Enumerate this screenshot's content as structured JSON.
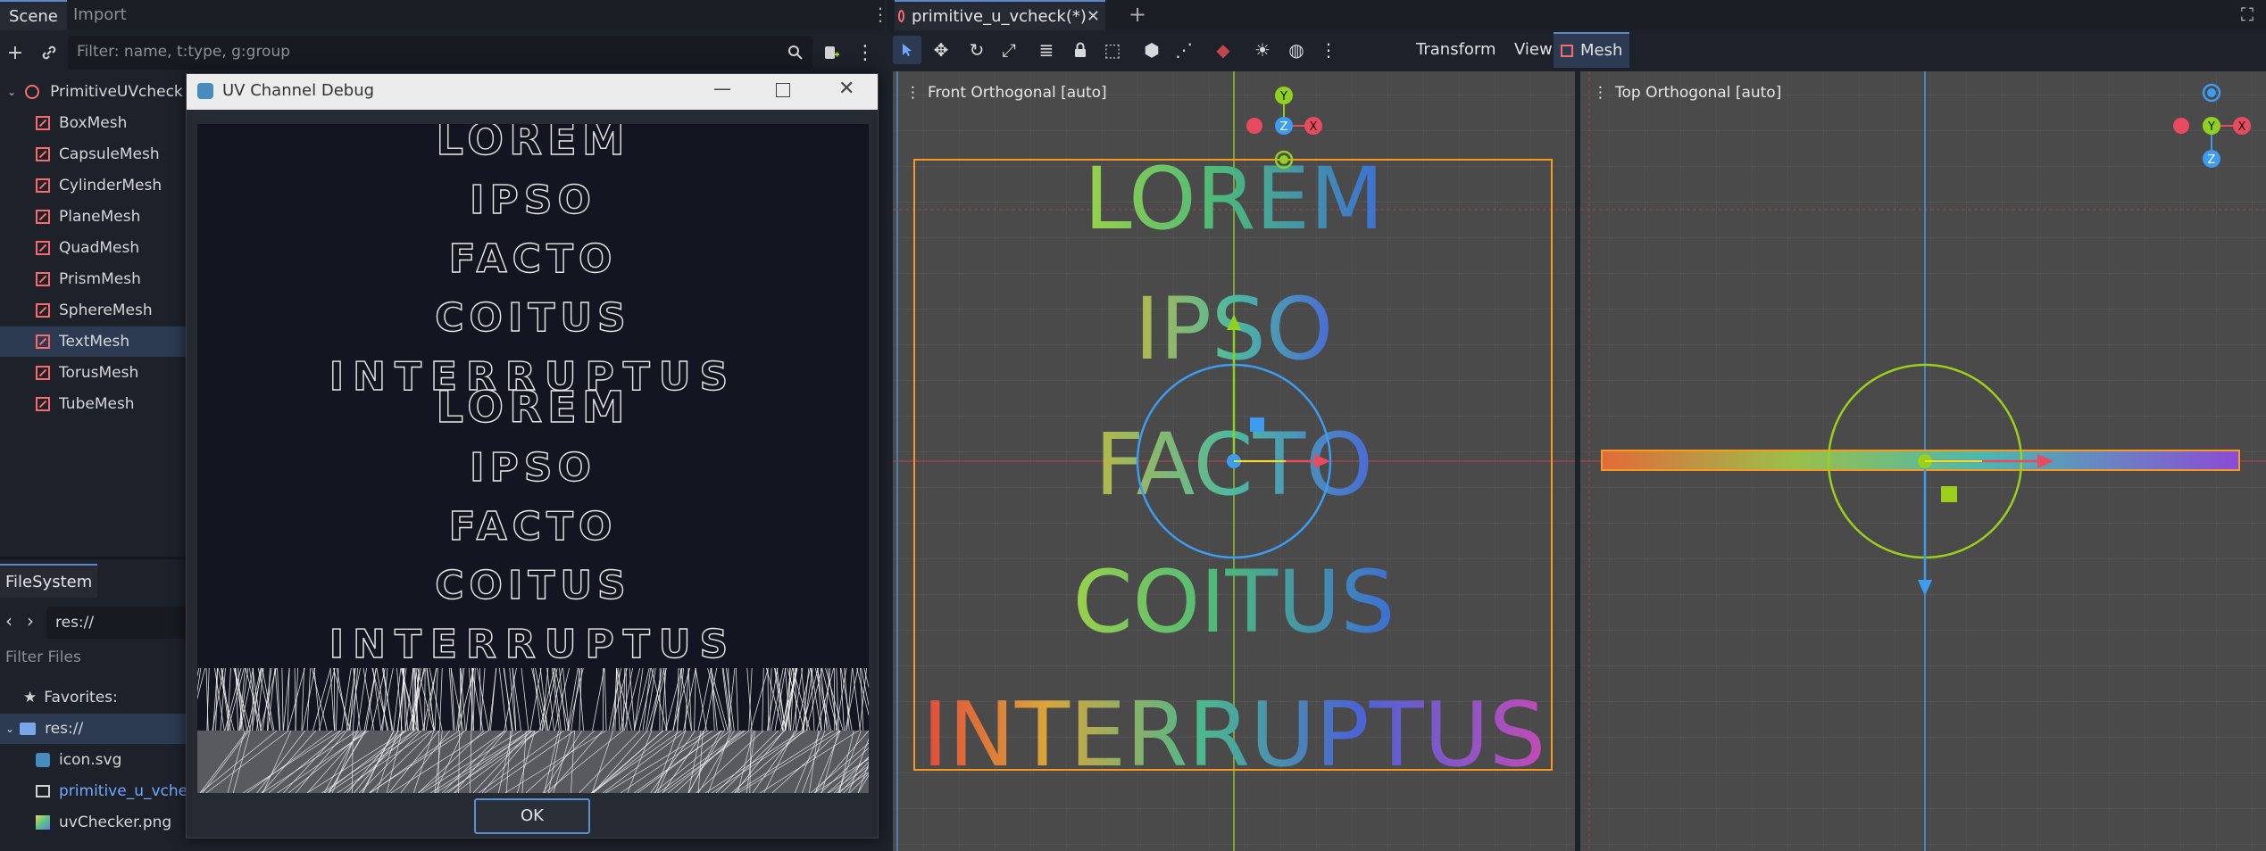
{
  "scene_dock": {
    "tabs": [
      "Scene",
      "Import"
    ],
    "filter_placeholder": "Filter: name, t:type, g:group",
    "root_node": "PrimitiveUVcheck",
    "nodes": [
      "BoxMesh",
      "CapsuleMesh",
      "CylinderMesh",
      "PlaneMesh",
      "QuadMesh",
      "PrismMesh",
      "SphereMesh",
      "TextMesh",
      "TorusMesh",
      "TubeMesh"
    ],
    "selected_node": "TextMesh"
  },
  "filesystem": {
    "tab": "FileSystem",
    "path": "res://",
    "filter_placeholder": "Filter Files",
    "favorites": "Favorites:",
    "root": "res://",
    "files": [
      "icon.svg",
      "primitive_u_vcheck",
      "uvChecker.png"
    ]
  },
  "dialog": {
    "title": "UV Channel Debug",
    "ok_label": "OK",
    "words": [
      "LOREM",
      "IPSO",
      "FACTO",
      "COITUS",
      "INTERRUPTUS"
    ]
  },
  "editor": {
    "scene_tab": "primitive_u_vcheck(*)",
    "menus": {
      "transform": "Transform",
      "view": "View",
      "mesh": "Mesh"
    },
    "front_viewport": "Front Orthogonal [auto]",
    "top_viewport": "Top Orthogonal [auto]",
    "gizmo_axes": {
      "x": "X",
      "y": "Y",
      "z": "Z"
    },
    "text_lines": [
      "LOREM",
      "IPSO",
      "FACTO",
      "COITUS",
      "INTERRUPTUS"
    ],
    "colors": {
      "accent": "#5f87c7",
      "x_axis": "#e84a5f",
      "y_axis": "#8fd11f",
      "z_axis": "#3d9bf0",
      "aabb": "#f79a1e"
    }
  }
}
